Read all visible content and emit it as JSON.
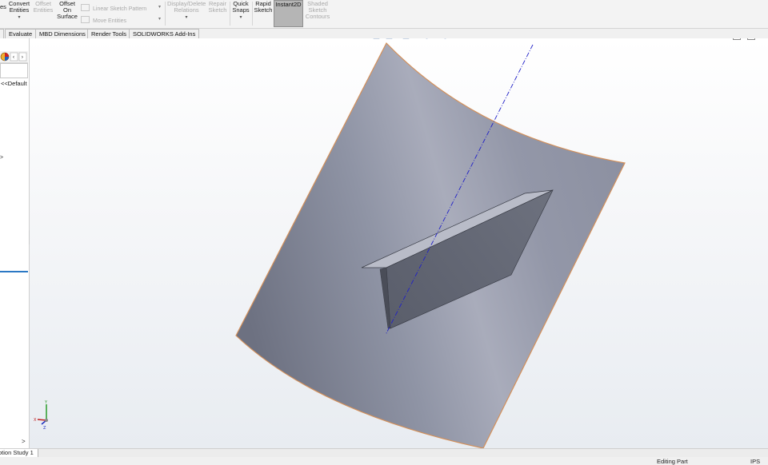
{
  "ribbon": {
    "partial_left_label": "es",
    "convert_entities": {
      "line1": "Convert",
      "line2": "Entities"
    },
    "offset_entities": {
      "line1": "Offset",
      "line2": "Entities"
    },
    "offset_on_surface": {
      "line1": "Offset",
      "line2": "On",
      "line3": "Surface"
    },
    "linear_sketch_pattern": "Linear Sketch Pattern",
    "move_entities": "Move Entities",
    "display_delete_relations": {
      "line1": "Display/Delete",
      "line2": "Relations"
    },
    "repair_sketch": {
      "line1": "Repair",
      "line2": "Sketch"
    },
    "quick_snaps": {
      "line1": "Quick",
      "line2": "Snaps"
    },
    "rapid_sketch": {
      "line1": "Rapid",
      "line2": "Sketch"
    },
    "instant2d": "Instant2D",
    "shaded_sketch_contours": {
      "line1": "Shaded",
      "line2": "Sketch",
      "line3": "Contours"
    }
  },
  "tabs": [
    {
      "label": "Evaluate"
    },
    {
      "label": "MBD Dimensions"
    },
    {
      "label": "Render Tools"
    },
    {
      "label": "SOLIDWORKS Add-Ins"
    }
  ],
  "left_panel": {
    "default_text": "<<Default",
    "arrow_text": ">",
    "scroll_right": ">"
  },
  "heads_up_toolbar": [
    "zoom-to-fit-icon",
    "zoom-to-area-icon",
    "previous-view-icon",
    "section-view-icon",
    "dynamic-annotation-icon",
    "view-orientation-icon",
    "display-style-icon",
    "hide-show-items-icon",
    "edit-appearance-icon",
    "apply-scene-icon",
    "view-settings-icon"
  ],
  "bottom": {
    "motion_study_tab": "otion Study 1"
  },
  "status_bar": {
    "mode": "Editing Part",
    "units": "IPS"
  },
  "colors": {
    "surface_edge": "#d4905a",
    "axis_line": "#2020c8",
    "active_tool_bg": "#b5b5b5",
    "panel_highlight": "#2b78c4"
  }
}
